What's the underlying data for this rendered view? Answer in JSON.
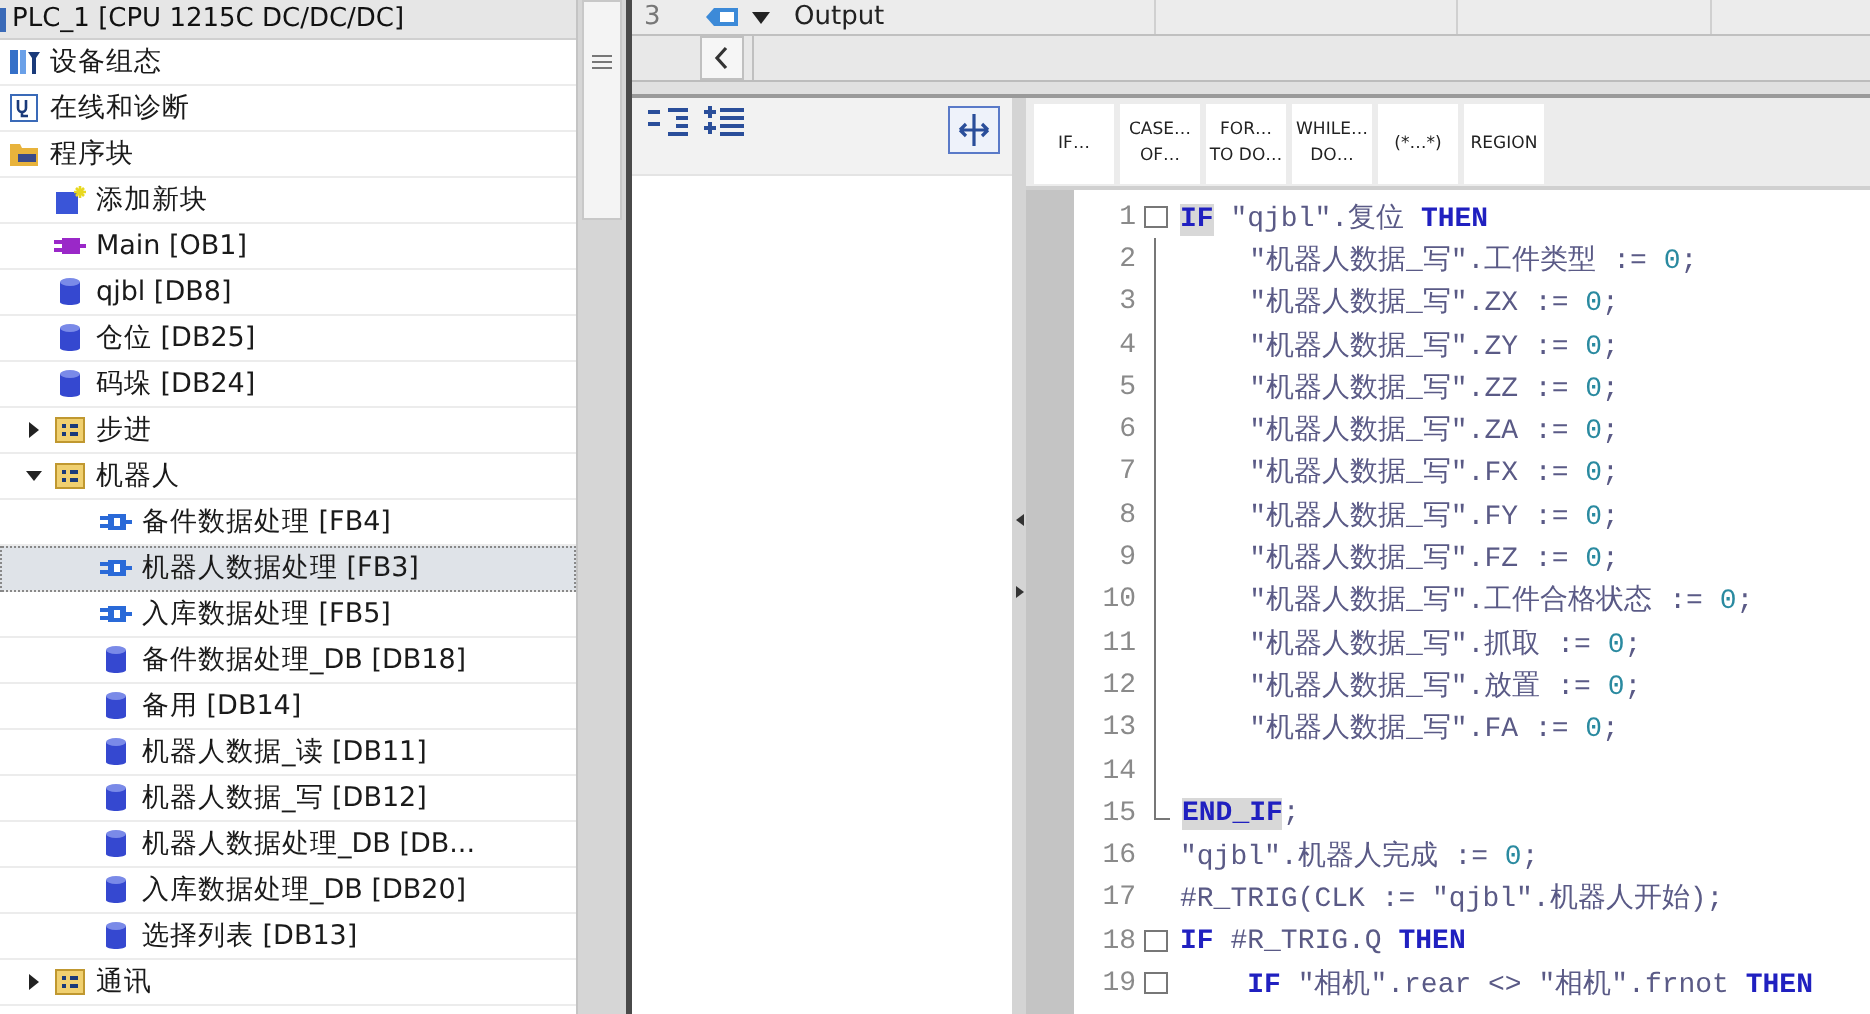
{
  "project_tree": {
    "title": "PLC_1 [CPU 1215C DC/DC/DC]",
    "items": [
      {
        "label": "设备组态",
        "kind": "device",
        "selected": false
      },
      {
        "label": "在线和诊断",
        "kind": "diagnostics",
        "selected": false
      },
      {
        "label": "程序块",
        "kind": "program",
        "selected": false,
        "children": [
          {
            "label": "添加新块",
            "kind": "add",
            "selected": false
          },
          {
            "label": "Main [OB1]",
            "kind": "ob",
            "selected": false
          },
          {
            "label": "qjbl [DB8]",
            "kind": "db",
            "selected": false
          },
          {
            "label": "仓位 [DB25]",
            "kind": "db",
            "selected": false
          },
          {
            "label": "码垛 [DB24]",
            "kind": "db",
            "selected": false
          },
          {
            "label": "步进",
            "kind": "group",
            "selected": false,
            "expanded": false
          },
          {
            "label": "机器人",
            "kind": "group",
            "selected": false,
            "expanded": true,
            "children": [
              {
                "label": "备件数据处理 [FB4]",
                "kind": "fb",
                "selected": false
              },
              {
                "label": "机器人数据处理 [FB3]",
                "kind": "fb",
                "selected": true
              },
              {
                "label": "入库数据处理 [FB5]",
                "kind": "fb",
                "selected": false
              },
              {
                "label": "备件数据处理_DB [DB18]",
                "kind": "db",
                "selected": false
              },
              {
                "label": "备用 [DB14]",
                "kind": "db",
                "selected": false
              },
              {
                "label": "机器人数据_读 [DB11]",
                "kind": "db",
                "selected": false
              },
              {
                "label": "机器人数据_写 [DB12]",
                "kind": "db",
                "selected": false
              },
              {
                "label": "机器人数据处理_DB [DB...",
                "kind": "db",
                "selected": false
              },
              {
                "label": "入库数据处理_DB [DB20]",
                "kind": "db",
                "selected": false
              },
              {
                "label": "选择列表 [DB13]",
                "kind": "db",
                "selected": false
              }
            ]
          },
          {
            "label": "通讯",
            "kind": "group",
            "selected": false,
            "expanded": false
          }
        ]
      }
    ]
  },
  "interface_row": {
    "number": "3",
    "label": "Output"
  },
  "snippets": [
    {
      "lines": [
        "IF…"
      ]
    },
    {
      "lines": [
        "CASE…",
        "OF…"
      ]
    },
    {
      "lines": [
        "FOR…",
        "TO DO…"
      ]
    },
    {
      "lines": [
        "WHILE…",
        "DO…"
      ]
    },
    {
      "lines": [
        "(*…*)"
      ]
    },
    {
      "lines": [
        "REGION"
      ]
    }
  ],
  "code": [
    {
      "number": "1",
      "kind": "start",
      "tokens": [
        {
          "kind": "kw-hl",
          "text": "IF"
        },
        {
          "kind": "text",
          "text": " \"qjbl\".复位 "
        },
        {
          "kind": "kw",
          "text": "THEN"
        }
      ]
    },
    {
      "number": "2",
      "kind": "body",
      "tokens": [
        {
          "kind": "text",
          "text": "    \"机器人数据_写\".工件类型 := "
        },
        {
          "kind": "num",
          "text": "0"
        },
        {
          "kind": "text",
          "text": ";"
        }
      ]
    },
    {
      "number": "3",
      "kind": "body",
      "tokens": [
        {
          "kind": "text",
          "text": "    \"机器人数据_写\".ZX := "
        },
        {
          "kind": "num",
          "text": "0"
        },
        {
          "kind": "text",
          "text": ";"
        }
      ]
    },
    {
      "number": "4",
      "kind": "body",
      "tokens": [
        {
          "kind": "text",
          "text": "    \"机器人数据_写\".ZY := "
        },
        {
          "kind": "num",
          "text": "0"
        },
        {
          "kind": "text",
          "text": ";"
        }
      ]
    },
    {
      "number": "5",
      "kind": "body",
      "tokens": [
        {
          "kind": "text",
          "text": "    \"机器人数据_写\".ZZ := "
        },
        {
          "kind": "num",
          "text": "0"
        },
        {
          "kind": "text",
          "text": ";"
        }
      ]
    },
    {
      "number": "6",
      "kind": "body",
      "tokens": [
        {
          "kind": "text",
          "text": "    \"机器人数据_写\".ZA := "
        },
        {
          "kind": "num",
          "text": "0"
        },
        {
          "kind": "text",
          "text": ";"
        }
      ]
    },
    {
      "number": "7",
      "kind": "body",
      "tokens": [
        {
          "kind": "text",
          "text": "    \"机器人数据_写\".FX := "
        },
        {
          "kind": "num",
          "text": "0"
        },
        {
          "kind": "text",
          "text": ";"
        }
      ]
    },
    {
      "number": "8",
      "kind": "body",
      "tokens": [
        {
          "kind": "text",
          "text": "    \"机器人数据_写\".FY := "
        },
        {
          "kind": "num",
          "text": "0"
        },
        {
          "kind": "text",
          "text": ";"
        }
      ]
    },
    {
      "number": "9",
      "kind": "body",
      "tokens": [
        {
          "kind": "text",
          "text": "    \"机器人数据_写\".FZ := "
        },
        {
          "kind": "num",
          "text": "0"
        },
        {
          "kind": "text",
          "text": ";"
        }
      ]
    },
    {
      "number": "10",
      "kind": "body",
      "tokens": [
        {
          "kind": "text",
          "text": "    \"机器人数据_写\".工件合格状态 := "
        },
        {
          "kind": "num",
          "text": "0"
        },
        {
          "kind": "text",
          "text": ";"
        }
      ]
    },
    {
      "number": "11",
      "kind": "body",
      "tokens": [
        {
          "kind": "text",
          "text": "    \"机器人数据_写\".抓取 := "
        },
        {
          "kind": "num",
          "text": "0"
        },
        {
          "kind": "text",
          "text": ";"
        }
      ]
    },
    {
      "number": "12",
      "kind": "body",
      "tokens": [
        {
          "kind": "text",
          "text": "    \"机器人数据_写\".放置 := "
        },
        {
          "kind": "num",
          "text": "0"
        },
        {
          "kind": "text",
          "text": ";"
        }
      ]
    },
    {
      "number": "13",
      "kind": "body",
      "tokens": [
        {
          "kind": "text",
          "text": "    \"机器人数据_写\".FA := "
        },
        {
          "kind": "num",
          "text": "0"
        },
        {
          "kind": "text",
          "text": ";"
        }
      ]
    },
    {
      "number": "14",
      "kind": "body"
    },
    {
      "number": "15",
      "kind": "end",
      "tokens": [
        {
          "kind": "kw-hl",
          "text": "END_IF"
        },
        {
          "kind": "text",
          "text": ";"
        }
      ]
    },
    {
      "number": "16",
      "kind": "plain",
      "tokens": [
        {
          "kind": "text",
          "text": "\"qjbl\".机器人完成 := "
        },
        {
          "kind": "num",
          "text": "0"
        },
        {
          "kind": "text",
          "text": ";"
        }
      ]
    },
    {
      "number": "17",
      "kind": "plain",
      "tokens": [
        {
          "kind": "text",
          "text": "#R_TRIG(CLK := \"qjbl\".机器人开始);"
        }
      ]
    },
    {
      "number": "18",
      "kind": "start",
      "tokens": [
        {
          "kind": "kw",
          "text": "IF"
        },
        {
          "kind": "text",
          "text": " #R_TRIG.Q "
        },
        {
          "kind": "kw",
          "text": "THEN"
        }
      ]
    },
    {
      "number": "19",
      "kind": "start",
      "tokens": [
        {
          "kind": "kw",
          "text": "    IF"
        },
        {
          "kind": "text",
          "text": " \"相机\".rear <> \"相机\".frnot "
        },
        {
          "kind": "kw",
          "text": "THEN"
        }
      ]
    }
  ]
}
